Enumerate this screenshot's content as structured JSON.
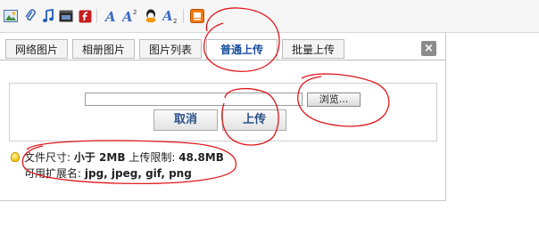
{
  "toolbar": {
    "icons": [
      "image-icon",
      "attachment-icon",
      "music-icon",
      "video-icon",
      "flash-icon",
      "font-color-icon",
      "superscript-icon",
      "emoticon-icon",
      "subscript-icon",
      "orange-app-icon"
    ]
  },
  "dialog": {
    "tabs": [
      {
        "label": "网络图片",
        "active": false
      },
      {
        "label": "相册图片",
        "active": false
      },
      {
        "label": "图片列表",
        "active": false
      },
      {
        "label": "普通上传",
        "active": true
      },
      {
        "label": "批量上传",
        "active": false
      }
    ],
    "close_label": "×",
    "file_input_value": "",
    "browse_label": "浏览...",
    "cancel_label": "取消",
    "upload_label": "上传",
    "info": {
      "size_label": "文件尺寸:",
      "size_value": "小于 2MB",
      "limit_label": "上传限制:",
      "limit_value": "48.8MB",
      "ext_label": "可用扩展名:",
      "ext_value": "jpg, jpeg, gif, png"
    }
  },
  "colors": {
    "annotation": "#e0161b",
    "accent": "#1b4fa0",
    "button_text": "#2a4f86"
  }
}
